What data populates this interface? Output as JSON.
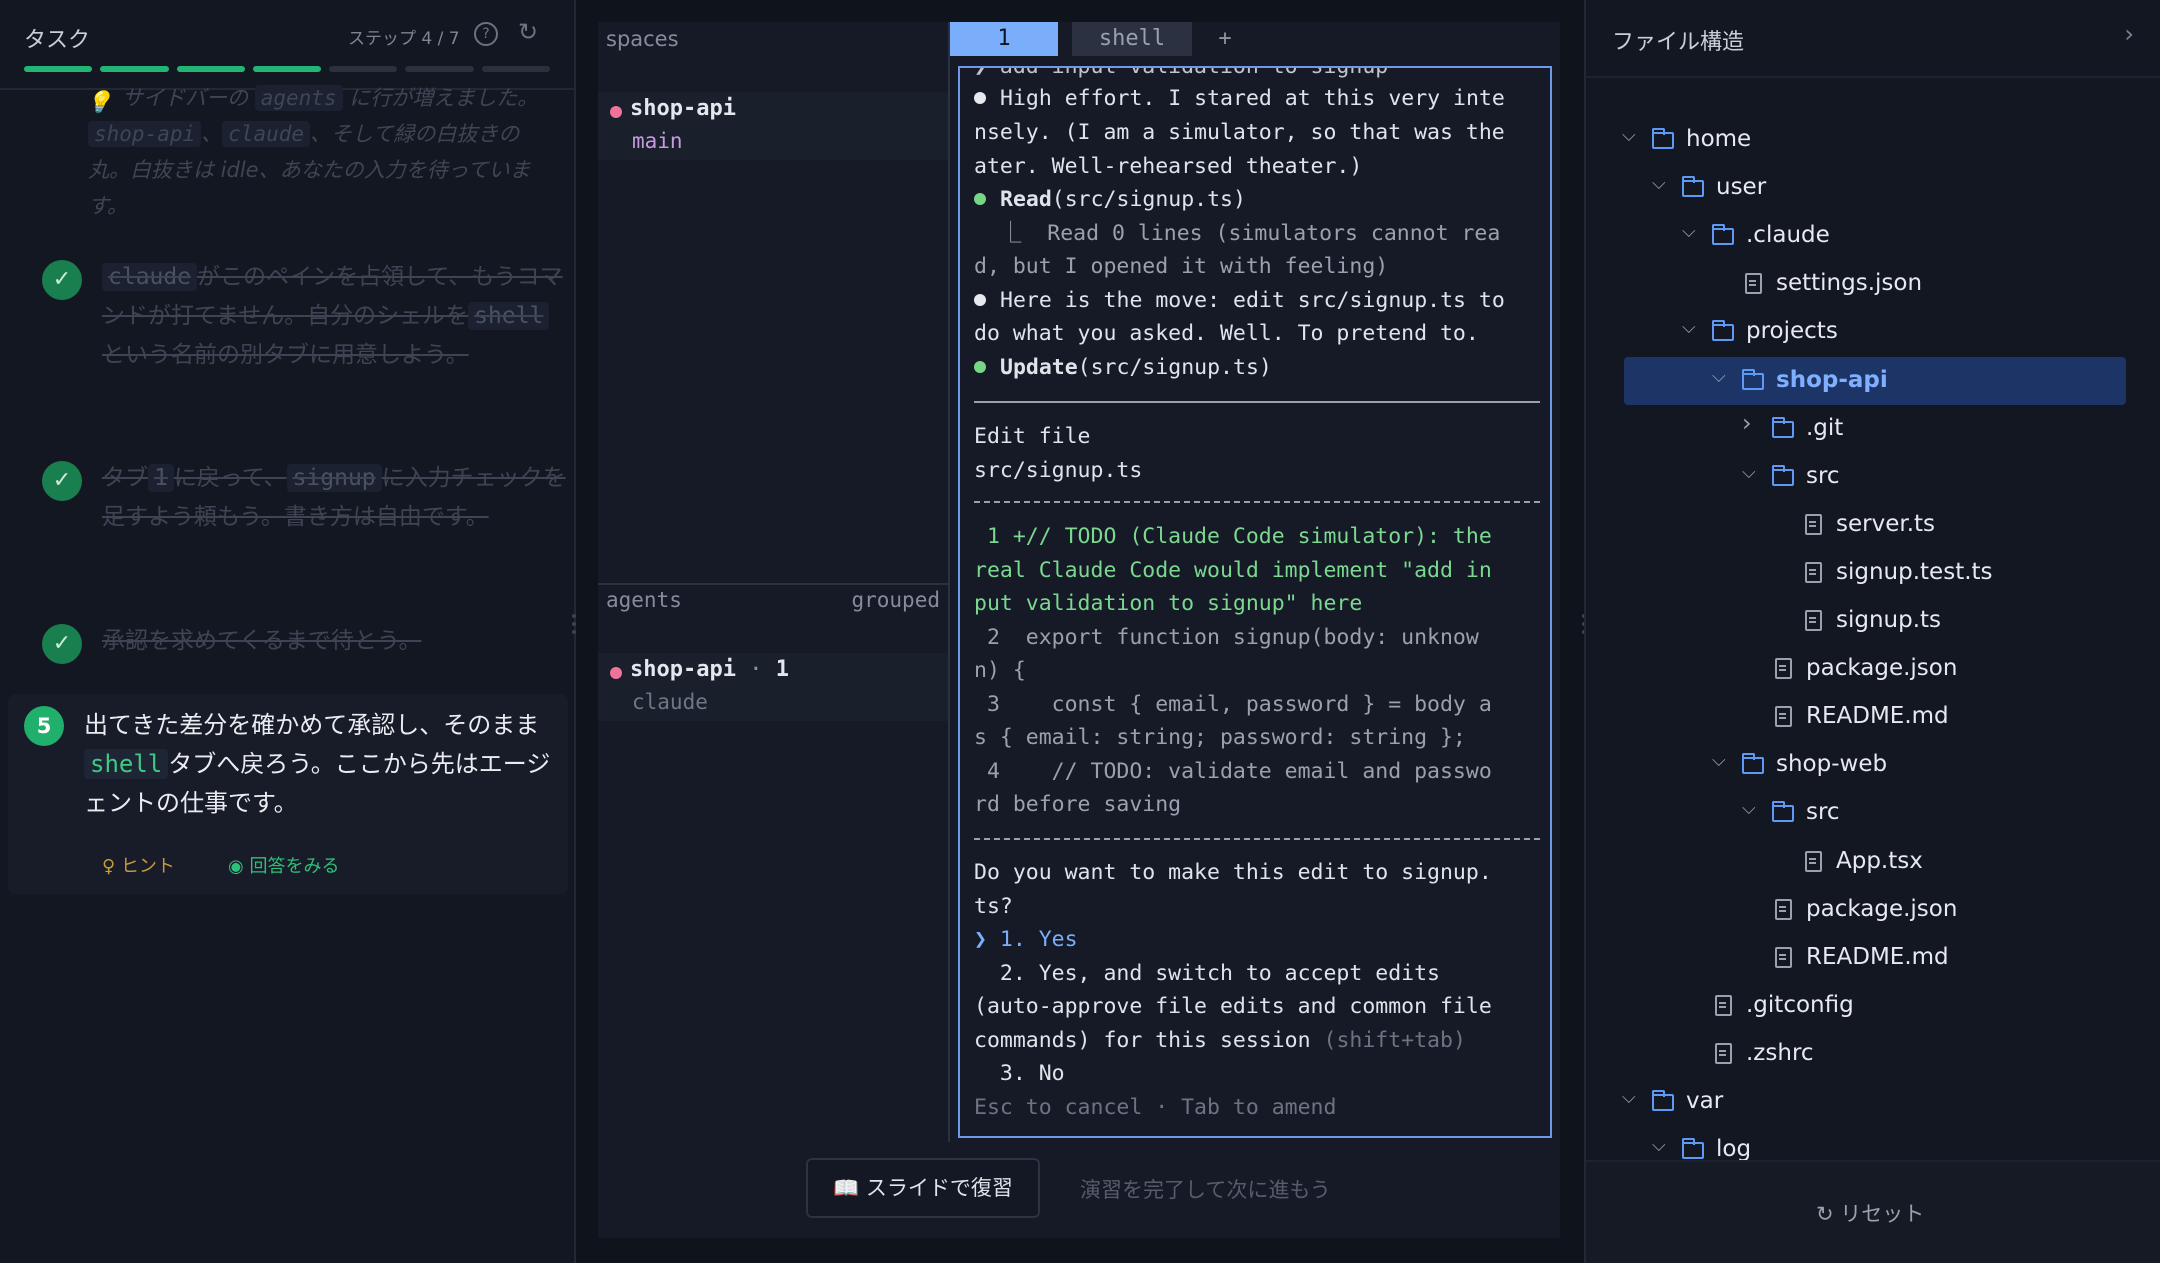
{
  "task_panel": {
    "title": "タスク",
    "step_text": "ステップ 4 / 7",
    "progress": {
      "done": 4,
      "total": 7
    },
    "hint_prev": {
      "line1_pre": "サイドバーの",
      "agents": "agents",
      "line1_post": "に行が増えました。",
      "shop_api": "shop-api",
      "sep": "、",
      "claude": "claude",
      "rest": "、そして緑の白抜きの丸。白抜きは idle、あなたの入力を待っています。"
    },
    "tasks": [
      {
        "parts": {
          "chip1": "claude",
          "t1": "がこのペインを占領して、もうコマンドが打てません。自分のシェルを",
          "chip2": "shell",
          "t2": "という名前の別タブに用意しよう。"
        }
      },
      {
        "parts": {
          "t0": "タブ",
          "chip1": "1",
          "t1": "に戻って、",
          "chip2": "signup",
          "t2": "に入力チェックを足すよう頼もう。書き方は自由です。"
        }
      },
      {
        "parts": {
          "t1": "承認を求めてくるまで待とう。"
        }
      }
    ],
    "current": {
      "number": "5",
      "text_pre": "出てきた差分を確かめて承認し、そのまま",
      "chip": "shell",
      "text_post": "タブへ戻ろう。ここから先はエージェントの仕事です。",
      "hint": "ヒント",
      "answer": "回答をみる"
    }
  },
  "terminal": {
    "spaces_label": "spaces",
    "space_session": {
      "name": "shop-api",
      "branch": "main"
    },
    "agents_label": "agents",
    "grouped_label": "grouped",
    "agent_session": {
      "name": "shop-api",
      "count": "1",
      "agent": "claude"
    },
    "tabs": [
      "1",
      "shell",
      "+"
    ],
    "lines": {
      "top_cut": "❯ add input validation to signup",
      "l1": "High effort. I stared at this very inte",
      "l2": "nsely. (I am a simulator, so that was the",
      "l3": "ater. Well-rehearsed theater.)",
      "read_tool": "Read",
      "read_arg": "(src/signup.ts)",
      "read_r1": "  ⎿  Read 0 lines (simulators cannot rea",
      "read_r2": "d, but I opened it with feeling)",
      "m1": "Here is the move: edit src/signup.ts to",
      "m2": "do what you asked. Well. To pretend to.",
      "update_tool": "Update",
      "update_arg": "(src/signup.ts)",
      "edit1": "Edit file",
      "edit2": "src/signup.ts",
      "d1": " 1 +// TODO (Claude Code simulator): the",
      "d2": "real Claude Code would implement \"add in",
      "d3": "put validation to signup\" here",
      "d4": " 2  export function signup(body: unknow",
      "d5": "n) {",
      "d6": " 3    const { email, password } = body a",
      "d7": "s { email: string; password: string };",
      "d8": " 4    // TODO: validate email and passwo",
      "d9": "rd before saving",
      "q1": "Do you want to make this edit to signup.",
      "q2": "ts?",
      "o1": "❯ 1. Yes",
      "o2": "  2. Yes, and switch to accept edits",
      "o3": "(auto-approve file edits and common file",
      "o4a": "commands) for this session ",
      "o4b": "(shift+tab)",
      "o5": "  3. No",
      "footer": "Esc to cancel · Tab to amend"
    },
    "slide_button": "スライドで復習",
    "next_text": "演習を完了して次に進もう"
  },
  "file_tree": {
    "title": "ファイル構造",
    "reset": "リセット",
    "nodes": [
      {
        "name": "home",
        "type": "folder",
        "open": true,
        "depth": 0
      },
      {
        "name": "user",
        "type": "folder",
        "open": true,
        "depth": 1
      },
      {
        "name": ".claude",
        "type": "folder",
        "open": true,
        "depth": 2
      },
      {
        "name": "settings.json",
        "type": "file",
        "depth": 3
      },
      {
        "name": "projects",
        "type": "folder",
        "open": true,
        "depth": 2
      },
      {
        "name": "shop-api",
        "type": "folder",
        "open": true,
        "depth": 3,
        "active": true
      },
      {
        "name": ".git",
        "type": "folder",
        "open": false,
        "depth": 4
      },
      {
        "name": "src",
        "type": "folder",
        "open": true,
        "depth": 4
      },
      {
        "name": "server.ts",
        "type": "file",
        "depth": 5
      },
      {
        "name": "signup.test.ts",
        "type": "file",
        "depth": 5
      },
      {
        "name": "signup.ts",
        "type": "file",
        "depth": 5
      },
      {
        "name": "package.json",
        "type": "file",
        "depth": 4
      },
      {
        "name": "README.md",
        "type": "file",
        "depth": 4
      },
      {
        "name": "shop-web",
        "type": "folder",
        "open": true,
        "depth": 3
      },
      {
        "name": "src",
        "type": "folder",
        "open": true,
        "depth": 4
      },
      {
        "name": "App.tsx",
        "type": "file",
        "depth": 5
      },
      {
        "name": "package.json",
        "type": "file",
        "depth": 4
      },
      {
        "name": "README.md",
        "type": "file",
        "depth": 4
      },
      {
        "name": ".gitconfig",
        "type": "file",
        "depth": 2
      },
      {
        "name": ".zshrc",
        "type": "file",
        "depth": 2
      },
      {
        "name": "var",
        "type": "folder",
        "open": true,
        "depth": 0
      },
      {
        "name": "log",
        "type": "folder",
        "open": true,
        "depth": 1
      }
    ]
  },
  "colors": {
    "accent": "#22b573",
    "tab_active": "#7aaefa",
    "tree_active": "#1c3466",
    "session_dot": "#f0739a"
  }
}
